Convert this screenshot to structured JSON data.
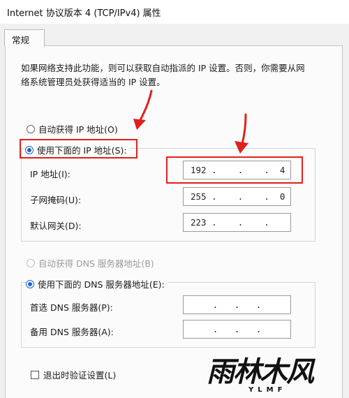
{
  "window": {
    "title": "Internet 协议版本 4 (TCP/IPv4) 属性"
  },
  "tabs": [
    {
      "label": "常规"
    }
  ],
  "description": {
    "line1": "如果网络支持此功能，则可以获取自动指派的 IP 设置。否则，你需要从网",
    "line2": "络系统管理员处获得适当的 IP 设置。"
  },
  "ip_section": {
    "auto_label": "自动获得 IP 地址(O)",
    "manual_label": "使用下面的 IP 地址(S):",
    "selected": "manual",
    "ip_label": "IP 地址(I):",
    "ip_value": "192 .    .    .  4",
    "subnet_label": "子网掩码(U):",
    "subnet_value": "255 .    .    .  0",
    "gateway_label": "默认网关(D):",
    "gateway_value": "223 .    .    ."
  },
  "dns_section": {
    "auto_label": "自动获得 DNS 服务器地址(B)",
    "manual_label": "使用下面的 DNS 服务器地址(E):",
    "selected": "manual",
    "preferred_label": "首选 DNS 服务器(P):",
    "alternate_label": "备用 DNS 服务器(A):",
    "dot": "."
  },
  "validate": {
    "label": "退出时验证设置(L)",
    "checked": false
  },
  "watermark": {
    "text": "雨林木风",
    "subtext": "YLMF"
  },
  "colors": {
    "highlight": "#e0201c",
    "accent": "#1a64c8",
    "background": "#f0f0f0"
  }
}
